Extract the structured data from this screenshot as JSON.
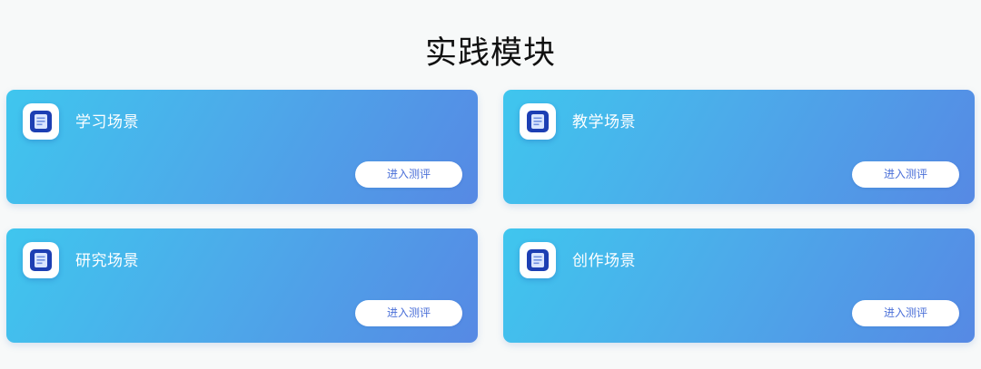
{
  "page": {
    "title": "实践模块"
  },
  "cards": [
    {
      "title": "学习场景",
      "button_label": "进入测评",
      "icon": "document-icon"
    },
    {
      "title": "教学场景",
      "button_label": "进入测评",
      "icon": "document-icon"
    },
    {
      "title": "研究场景",
      "button_label": "进入测评",
      "icon": "document-icon"
    },
    {
      "title": "创作场景",
      "button_label": "进入测评",
      "icon": "document-icon"
    }
  ],
  "colors": {
    "background": "#f7f9f9",
    "card_gradient_start": "#3fc6ee",
    "card_gradient_end": "#5689e4",
    "icon_blue": "#1d3fb3",
    "button_text": "#4a6fd8"
  }
}
